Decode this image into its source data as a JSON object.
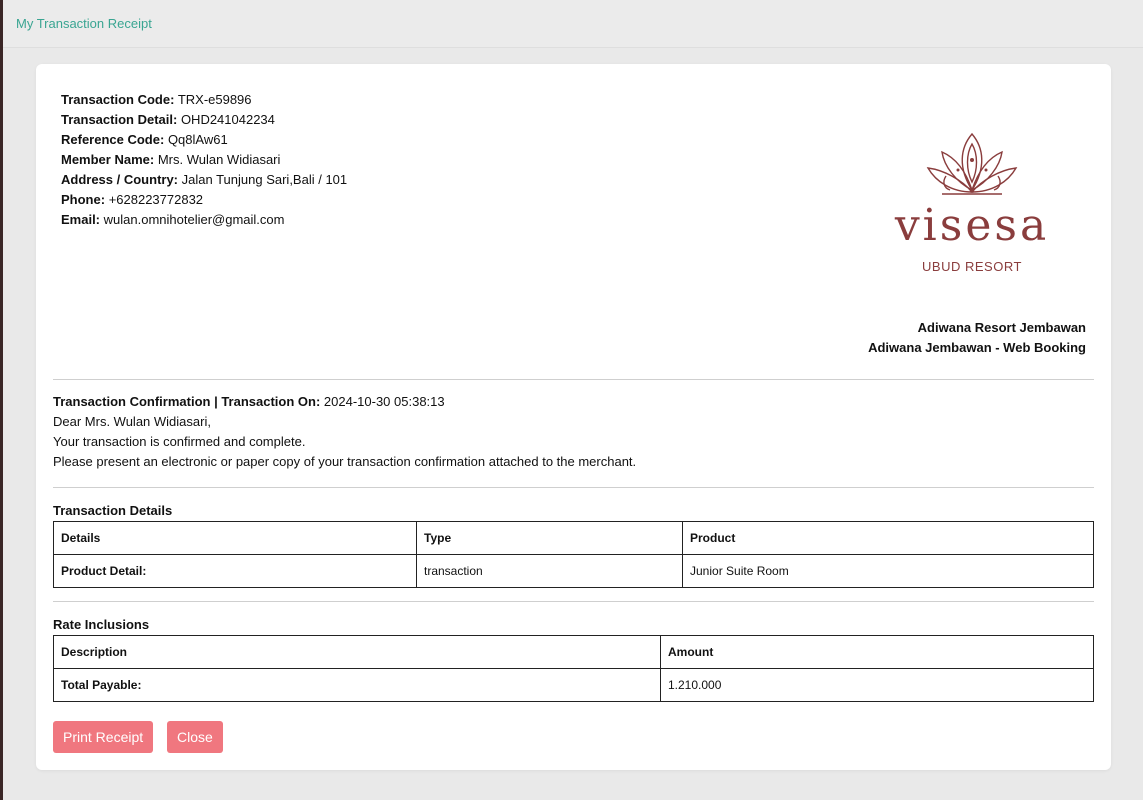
{
  "header": {
    "title": "My Transaction Receipt"
  },
  "info": [
    {
      "label": "Transaction Code:",
      "value": "TRX-e59896"
    },
    {
      "label": "Transaction Detail:",
      "value": "OHD241042234"
    },
    {
      "label": "Reference Code:",
      "value": "Qq8lAw61"
    },
    {
      "label": "Member Name:",
      "value": "Mrs. Wulan Widiasari"
    },
    {
      "label": "Address / Country:",
      "value": "Jalan Tunjung Sari,Bali / 101"
    },
    {
      "label": "Phone:",
      "value": "+628223772832"
    },
    {
      "label": "Email:",
      "value": "wulan.omnihotelier@gmail.com"
    }
  ],
  "logo": {
    "word": "visesa",
    "sub": "UBUD RESORT",
    "color": "#8a3d3d"
  },
  "merchant": {
    "line1": "Adiwana Resort Jembawan",
    "line2": "Adiwana Jembawan - Web Booking"
  },
  "confirmation": {
    "heading": "Transaction Confirmation | Transaction On:",
    "datetime": "2024-10-30 05:38:13",
    "greeting": "Dear Mrs. Wulan Widiasari,",
    "line1": "Your transaction is confirmed and complete.",
    "line2": "Please present an electronic or paper copy of your transaction confirmation attached to the merchant."
  },
  "transaction_details": {
    "title": "Transaction Details",
    "headers": [
      "Details",
      "Type",
      "Product"
    ],
    "row": [
      "Product Detail:",
      "transaction",
      "Junior Suite Room"
    ]
  },
  "rate_inclusions": {
    "title": "Rate Inclusions",
    "headers": [
      "Description",
      "Amount"
    ],
    "row": [
      "Total Payable:",
      "1.210.000"
    ]
  },
  "buttons": {
    "print": "Print Receipt",
    "close": "Close"
  },
  "colors": {
    "accent": "#3aa592",
    "button": "#f0777f"
  }
}
